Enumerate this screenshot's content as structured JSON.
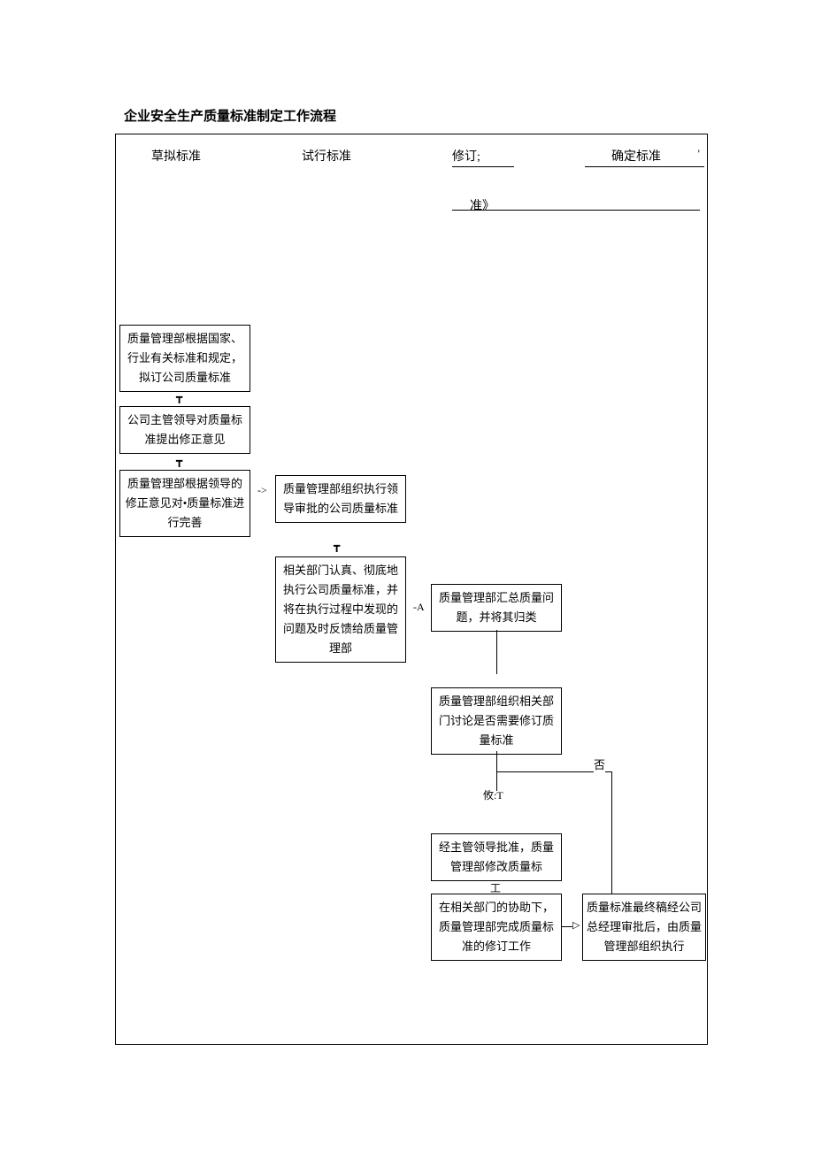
{
  "title": "企业安全生产质量标准制定工作流程",
  "columns": {
    "c1": "草拟标准",
    "c2": "试行标准",
    "c3": "修订;",
    "c4": "确定标准"
  },
  "tick_mark": "'",
  "zhun_fragment": "准》",
  "col1": {
    "b1": "质量管理部根据国家、行业有关标准和规定，拟订公司质量标准",
    "b2": "公司主管领导对质量标准提出修正意见",
    "b3": "质量管理部根据领导的修正意见对•质量标准进行完善"
  },
  "col2": {
    "b1": "质量管理部组织执行领导审批的公司质量标准",
    "b2": "相关部门认真、彻底地执行公司质量标准，并将在执行过程中发现的问题及时反馈给质量管理部"
  },
  "col3": {
    "b1": "质量管理部汇总质量问题，并将其归类",
    "b2": "质量管理部组织相关部门讨论是否需要修订质量标准",
    "b3": "经主管领导批准，质量管理部修改质量标",
    "b4": "在相关部门的协助下，质量管理部完成质量标准的修订工作"
  },
  "col4": {
    "b1": "质量标准最终稿经公司总经理审批后，由质量管理部组织执行"
  },
  "connectors": {
    "t1": "┳",
    "t2": "┳",
    "t3": "┳",
    "arrow_r1": "->",
    "arrow_a": "-A",
    "gong": "工",
    "you_t": "攸:T",
    "arrow_r2": "▷",
    "arrow_r3": "▷"
  },
  "labels": {
    "no": "否"
  }
}
